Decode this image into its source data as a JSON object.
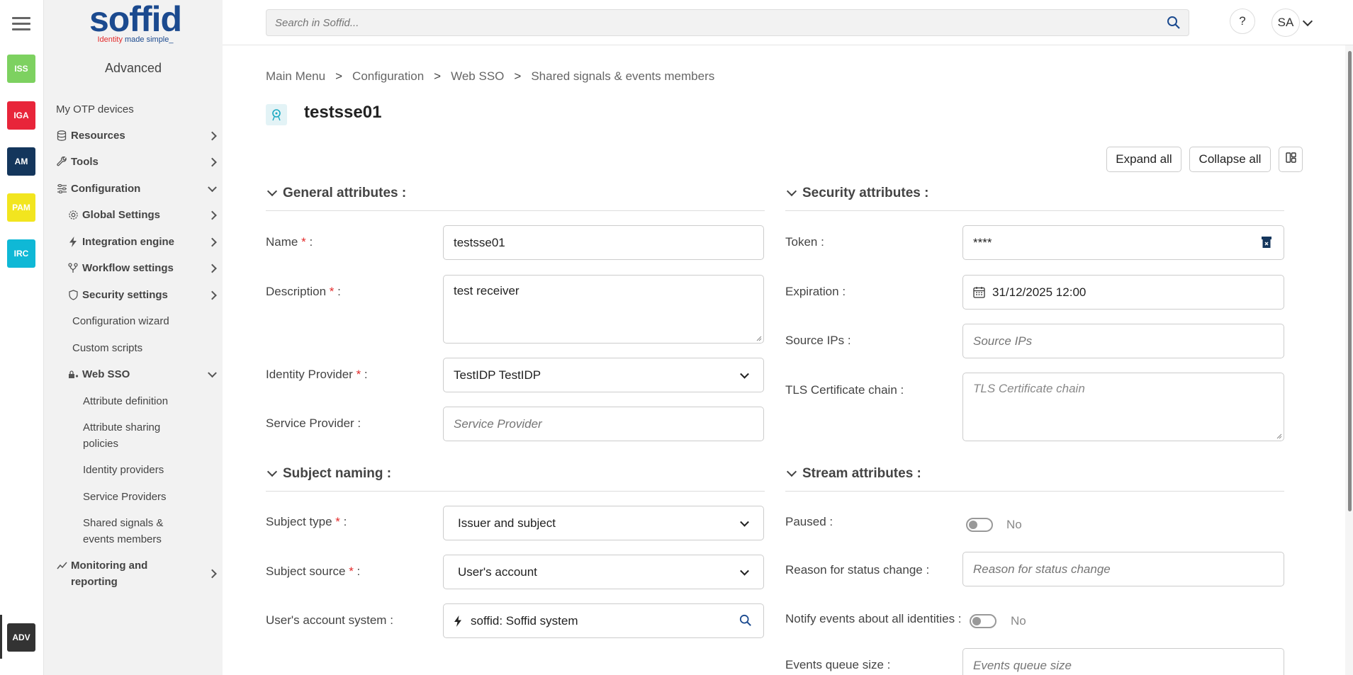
{
  "rail": {
    "apps": [
      {
        "label": "ISS",
        "color": "#7dd160"
      },
      {
        "label": "IGA",
        "color": "#e8253a"
      },
      {
        "label": "AM",
        "color": "#14365c"
      },
      {
        "label": "PAM",
        "color": "#f2e51f"
      },
      {
        "label": "IRC",
        "color": "#0fb8d6"
      }
    ],
    "active": "ADV"
  },
  "sidebar": {
    "logo": "soffid",
    "tagline_red": "Identity",
    "tagline_rest": " made simple_",
    "section": "Advanced",
    "items": [
      {
        "label": "My OTP devices"
      },
      {
        "label": "Resources"
      },
      {
        "label": "Tools"
      },
      {
        "label": "Configuration"
      },
      {
        "label": "Global Settings"
      },
      {
        "label": "Integration engine"
      },
      {
        "label": "Workflow settings"
      },
      {
        "label": "Security settings"
      },
      {
        "label": "Configuration wizard"
      },
      {
        "label": "Custom scripts"
      },
      {
        "label": "Web SSO"
      },
      {
        "label": "Attribute definition"
      },
      {
        "label": "Attribute sharing policies"
      },
      {
        "label": "Identity providers"
      },
      {
        "label": "Service Providers"
      },
      {
        "label": "Shared signals & events members"
      },
      {
        "label": "Monitoring and reporting"
      }
    ]
  },
  "header": {
    "search_placeholder": "Search in Soffid...",
    "help": "?",
    "user_initials": "SA"
  },
  "breadcrumb": [
    "Main Menu",
    "Configuration",
    "Web SSO",
    "Shared signals & events members"
  ],
  "breadcrumb_sep": ">",
  "page": {
    "title": "testsse01",
    "expand_all": "Expand all",
    "collapse_all": "Collapse all"
  },
  "general": {
    "title": "General attributes :",
    "name_label": "Name",
    "name_value": "testsse01",
    "description_label": "Description",
    "description_value": "test receiver",
    "idp_label": "Identity Provider",
    "idp_value": "TestIDP TestIDP",
    "sp_label": "Service Provider :",
    "sp_placeholder": "Service Provider"
  },
  "subject": {
    "title": "Subject naming :",
    "type_label": "Subject type",
    "type_value": "Issuer and subject",
    "source_label": "Subject source",
    "source_value": "User's account",
    "system_label": "User's account system :",
    "system_value": "soffid: Soffid system"
  },
  "security": {
    "title": "Security attributes :",
    "token_label": "Token :",
    "token_value": "****",
    "expiration_label": "Expiration :",
    "expiration_value": "31/12/2025 12:00",
    "ips_label": "Source IPs :",
    "ips_placeholder": "Source IPs",
    "tls_label": "TLS Certificate chain :",
    "tls_placeholder": "TLS Certificate chain"
  },
  "stream": {
    "title": "Stream attributes :",
    "paused_label": "Paused :",
    "paused_value": "No",
    "reason_label": "Reason for status change :",
    "reason_placeholder": "Reason for status change",
    "notify_label": "Notify events about all identities :",
    "notify_value": "No",
    "queue_label": "Events queue size :",
    "queue_placeholder": "Events queue size"
  },
  "required_mark": "*",
  "colon": " :"
}
